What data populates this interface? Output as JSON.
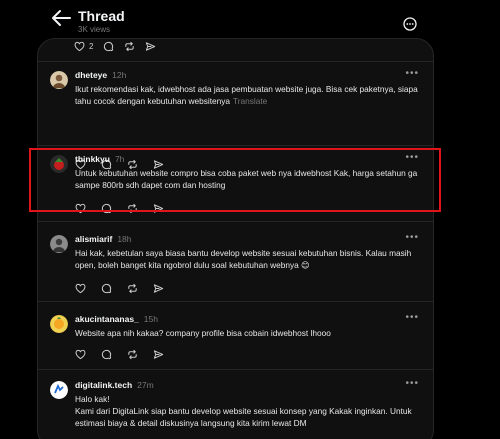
{
  "header": {
    "title": "Thread",
    "subtitle": "3K views"
  },
  "top_actions": {
    "like_count": "2"
  },
  "posts": [
    {
      "username": "dheteye",
      "time": "12h",
      "text": "Ikut rekomendasi kak, idwebhost ada jasa pembuatan website juga. Bisa cek paketnya, siapa tahu cocok dengan kebutuhan websitenya",
      "translate": "Translate"
    },
    {
      "username": "thinkkyu",
      "time": "7h",
      "text": "Untuk kebutuhan website compro bisa coba paket web nya idwebhost Kak, harga setahun ga sampe 800rb sdh dapet com dan hosting"
    },
    {
      "username": "alismiarif",
      "time": "18h",
      "text": "Hai kak, kebetulan saya biasa bantu develop website sesuai kebutuhan bisnis. Kalau masih open, boleh banget kita ngobrol dulu soal kebutuhan webnya 😊"
    },
    {
      "username": "akucintananas_",
      "time": "15h",
      "text": "Website apa nih kakaa? company profile bisa cobain idwebhost lhooo"
    },
    {
      "username": "digitalink.tech",
      "time": "27m",
      "text": "Halo kak!",
      "text2": "Kami dari DigitaLink siap bantu develop website sesuai konsep yang Kakak inginkan. Untuk estimasi biaya & detail diskusinya langsung kita kirim lewat DM"
    }
  ],
  "icons": {
    "back": "arrow-left-icon",
    "more": "more-circle-icon",
    "like": "heart-icon",
    "reply": "comment-icon",
    "repost": "repost-icon",
    "share": "send-icon"
  },
  "colors": {
    "background": "#000000",
    "panel": "#101010",
    "highlight": "#e0141b",
    "muted": "#777777"
  }
}
